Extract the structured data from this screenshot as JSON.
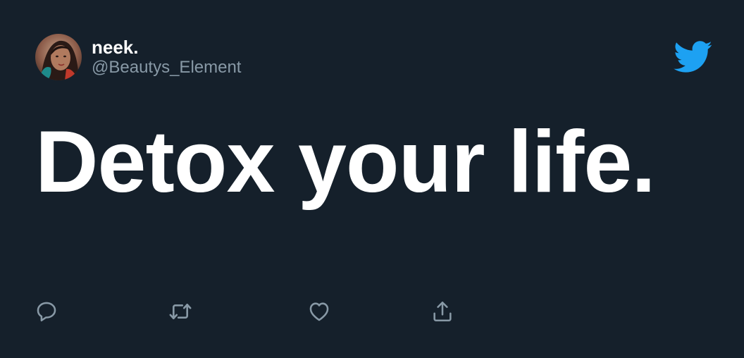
{
  "author": {
    "display_name": "neek.",
    "handle": "@Beautys_Element",
    "avatar_icon": "profile-photo"
  },
  "tweet": {
    "text": "Detox your life."
  },
  "brand": {
    "icon": "twitter-bird-icon",
    "color": "#1da1f2"
  },
  "actions": [
    {
      "name": "reply",
      "icon": "speech-bubble-icon"
    },
    {
      "name": "retweet",
      "icon": "retweet-arrows-icon"
    },
    {
      "name": "like",
      "icon": "heart-icon"
    },
    {
      "name": "share",
      "icon": "share-upload-icon"
    }
  ],
  "colors": {
    "background": "#15202b",
    "text_primary": "#ffffff",
    "text_secondary": "#8899a6",
    "action_icons": "#8899a6"
  }
}
